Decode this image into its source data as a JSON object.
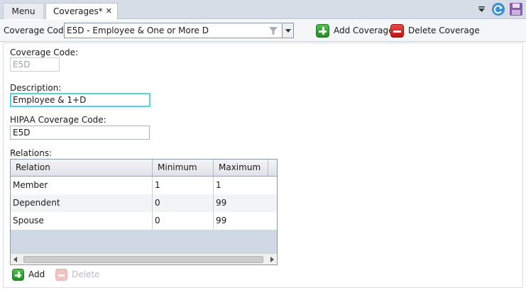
{
  "tabs": {
    "menu_label": "Menu",
    "coverages_label": "Coverages*",
    "close_glyph": "✕"
  },
  "window_controls": {
    "dropdown_icon": "dropdown-arrow-icon",
    "refresh_icon": "refresh-icon",
    "save_icon": "save-disk-icon"
  },
  "toolbar": {
    "coverage_code_label": "Coverage Code:",
    "coverage_code_value": "E5D - Employee & One or More D",
    "filter_icon": "filter-funnel-icon",
    "add_coverage_label": "Add Coverage",
    "delete_coverage_label": "Delete Coverage"
  },
  "form": {
    "coverage_code_label": "Coverage Code:",
    "coverage_code_value": "E5D",
    "description_label": "Description:",
    "description_value": "Employee & 1+D",
    "hipaa_label": "HIPAA Coverage Code:",
    "hipaa_value": "E5D",
    "relations_label": "Relations:"
  },
  "relations_grid": {
    "columns": [
      "Relation",
      "Minimum",
      "Maximum"
    ],
    "rows": [
      {
        "relation": "Member",
        "minimum": "1",
        "maximum": "1"
      },
      {
        "relation": "Dependent",
        "minimum": "0",
        "maximum": "99"
      },
      {
        "relation": "Spouse",
        "minimum": "0",
        "maximum": "99"
      }
    ],
    "add_label": "Add",
    "delete_label": "Delete"
  },
  "colors": {
    "accent_focus": "#4fd6e6",
    "add_green": "#2aa52f",
    "delete_red": "#d32222"
  }
}
